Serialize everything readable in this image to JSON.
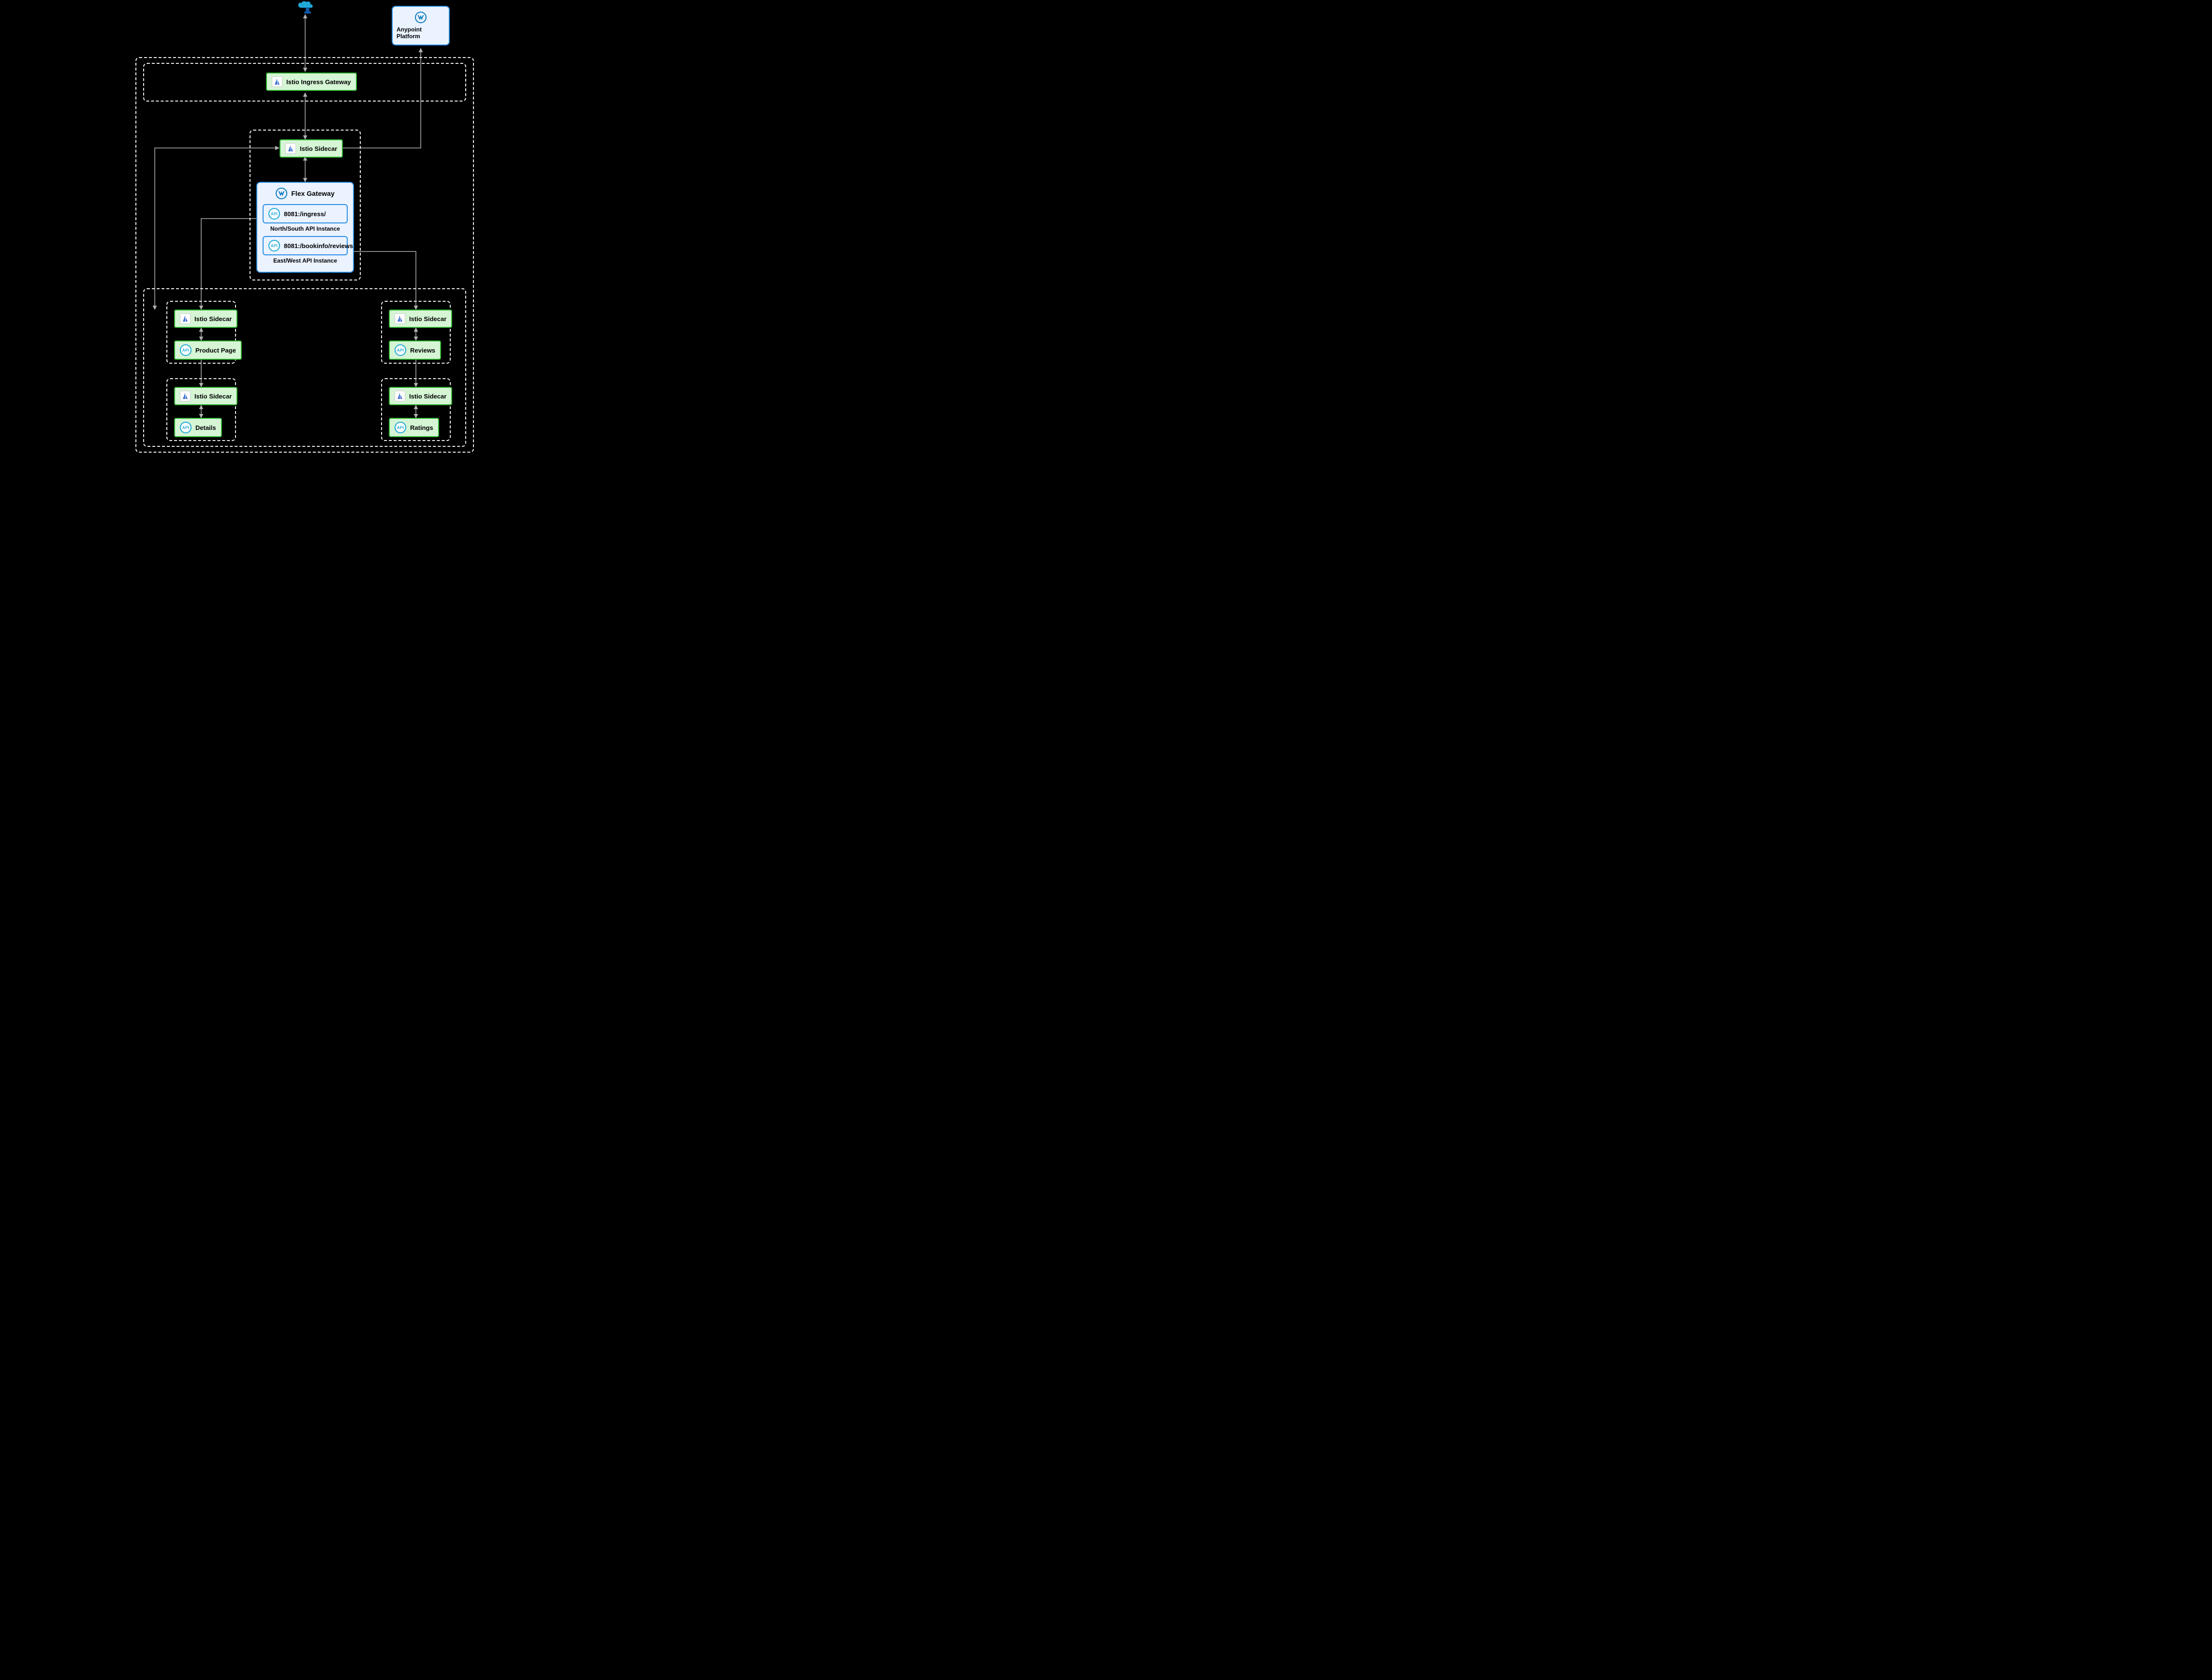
{
  "cloud": {
    "alt": "External user / internet"
  },
  "anypoint": {
    "label": "Anypoint Platform"
  },
  "ingress": {
    "label": "Istio Ingress Gateway"
  },
  "flexGateway": {
    "title": "Flex Gateway",
    "api1": {
      "badge": "API",
      "label": "8081:/ingress/"
    },
    "api1Caption": "North/South API Instance",
    "api2": {
      "badge": "API",
      "label": "8081:/bookinfo/reviews"
    },
    "api2Caption": "East/West API Instance"
  },
  "sidecarTop": {
    "label": "Istio Sidecar"
  },
  "productPod": {
    "sidecar": "Istio Sidecar",
    "apiBadge": "API",
    "apiLabel": "Product Page"
  },
  "detailsPod": {
    "sidecar": "Istio Sidecar",
    "apiBadge": "API",
    "apiLabel": "Details"
  },
  "reviewsPod": {
    "sidecar": "Istio Sidecar",
    "apiBadge": "API",
    "apiLabel": "Reviews"
  },
  "ratingsPod": {
    "sidecar": "Istio Sidecar",
    "apiBadge": "API",
    "apiLabel": "Ratings"
  },
  "colors": {
    "green": "#d5f5d5",
    "greenBorder": "#2fb32f",
    "blue": "#eaf3ff",
    "blueBorder": "#2d8fe5",
    "connector": "#b0b0b0",
    "dash": "#f0f0f0"
  }
}
